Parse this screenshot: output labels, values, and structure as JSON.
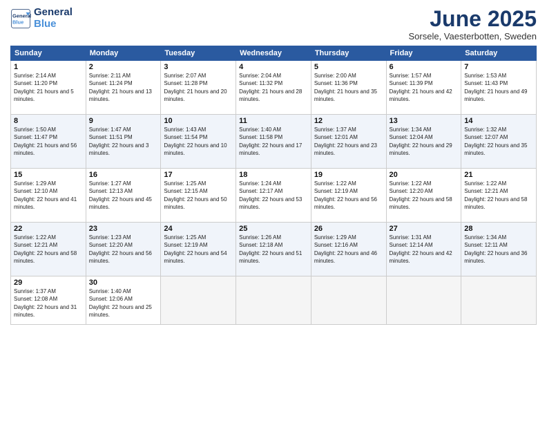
{
  "logo": {
    "line1": "General",
    "line2": "Blue"
  },
  "title": "June 2025",
  "subtitle": "Sorsele, Vaesterbotten, Sweden",
  "days_of_week": [
    "Sunday",
    "Monday",
    "Tuesday",
    "Wednesday",
    "Thursday",
    "Friday",
    "Saturday"
  ],
  "weeks": [
    [
      {
        "day": "1",
        "sunrise": "2:14 AM",
        "sunset": "11:20 PM",
        "daylight": "21 hours and 5 minutes."
      },
      {
        "day": "2",
        "sunrise": "2:11 AM",
        "sunset": "11:24 PM",
        "daylight": "21 hours and 13 minutes."
      },
      {
        "day": "3",
        "sunrise": "2:07 AM",
        "sunset": "11:28 PM",
        "daylight": "21 hours and 20 minutes."
      },
      {
        "day": "4",
        "sunrise": "2:04 AM",
        "sunset": "11:32 PM",
        "daylight": "21 hours and 28 minutes."
      },
      {
        "day": "5",
        "sunrise": "2:00 AM",
        "sunset": "11:36 PM",
        "daylight": "21 hours and 35 minutes."
      },
      {
        "day": "6",
        "sunrise": "1:57 AM",
        "sunset": "11:39 PM",
        "daylight": "21 hours and 42 minutes."
      },
      {
        "day": "7",
        "sunrise": "1:53 AM",
        "sunset": "11:43 PM",
        "daylight": "21 hours and 49 minutes."
      }
    ],
    [
      {
        "day": "8",
        "sunrise": "1:50 AM",
        "sunset": "11:47 PM",
        "daylight": "21 hours and 56 minutes."
      },
      {
        "day": "9",
        "sunrise": "1:47 AM",
        "sunset": "11:51 PM",
        "daylight": "22 hours and 3 minutes."
      },
      {
        "day": "10",
        "sunrise": "1:43 AM",
        "sunset": "11:54 PM",
        "daylight": "22 hours and 10 minutes."
      },
      {
        "day": "11",
        "sunrise": "1:40 AM",
        "sunset": "11:58 PM",
        "daylight": "22 hours and 17 minutes."
      },
      {
        "day": "12",
        "sunrise": "1:37 AM",
        "sunset": "12:01 AM",
        "daylight": "22 hours and 23 minutes."
      },
      {
        "day": "13",
        "sunrise": "1:34 AM",
        "sunset": "12:04 AM",
        "daylight": "22 hours and 29 minutes."
      },
      {
        "day": "14",
        "sunrise": "1:32 AM",
        "sunset": "12:07 AM",
        "daylight": "22 hours and 35 minutes."
      }
    ],
    [
      {
        "day": "15",
        "sunrise": "1:29 AM",
        "sunset": "12:10 AM",
        "daylight": "22 hours and 41 minutes."
      },
      {
        "day": "16",
        "sunrise": "1:27 AM",
        "sunset": "12:13 AM",
        "daylight": "22 hours and 45 minutes."
      },
      {
        "day": "17",
        "sunrise": "1:25 AM",
        "sunset": "12:15 AM",
        "daylight": "22 hours and 50 minutes."
      },
      {
        "day": "18",
        "sunrise": "1:24 AM",
        "sunset": "12:17 AM",
        "daylight": "22 hours and 53 minutes."
      },
      {
        "day": "19",
        "sunrise": "1:22 AM",
        "sunset": "12:19 AM",
        "daylight": "22 hours and 56 minutes."
      },
      {
        "day": "20",
        "sunrise": "1:22 AM",
        "sunset": "12:20 AM",
        "daylight": "22 hours and 58 minutes."
      },
      {
        "day": "21",
        "sunrise": "1:22 AM",
        "sunset": "12:21 AM",
        "daylight": "22 hours and 58 minutes."
      }
    ],
    [
      {
        "day": "22",
        "sunrise": "1:22 AM",
        "sunset": "12:21 AM",
        "daylight": "22 hours and 58 minutes."
      },
      {
        "day": "23",
        "sunrise": "1:23 AM",
        "sunset": "12:20 AM",
        "daylight": "22 hours and 56 minutes."
      },
      {
        "day": "24",
        "sunrise": "1:25 AM",
        "sunset": "12:19 AM",
        "daylight": "22 hours and 54 minutes."
      },
      {
        "day": "25",
        "sunrise": "1:26 AM",
        "sunset": "12:18 AM",
        "daylight": "22 hours and 51 minutes."
      },
      {
        "day": "26",
        "sunrise": "1:29 AM",
        "sunset": "12:16 AM",
        "daylight": "22 hours and 46 minutes."
      },
      {
        "day": "27",
        "sunrise": "1:31 AM",
        "sunset": "12:14 AM",
        "daylight": "22 hours and 42 minutes."
      },
      {
        "day": "28",
        "sunrise": "1:34 AM",
        "sunset": "12:11 AM",
        "daylight": "22 hours and 36 minutes."
      }
    ],
    [
      {
        "day": "29",
        "sunrise": "1:37 AM",
        "sunset": "12:08 AM",
        "daylight": "22 hours and 31 minutes."
      },
      {
        "day": "30",
        "sunrise": "1:40 AM",
        "sunset": "12:06 AM",
        "daylight": "22 hours and 25 minutes."
      },
      null,
      null,
      null,
      null,
      null
    ]
  ]
}
